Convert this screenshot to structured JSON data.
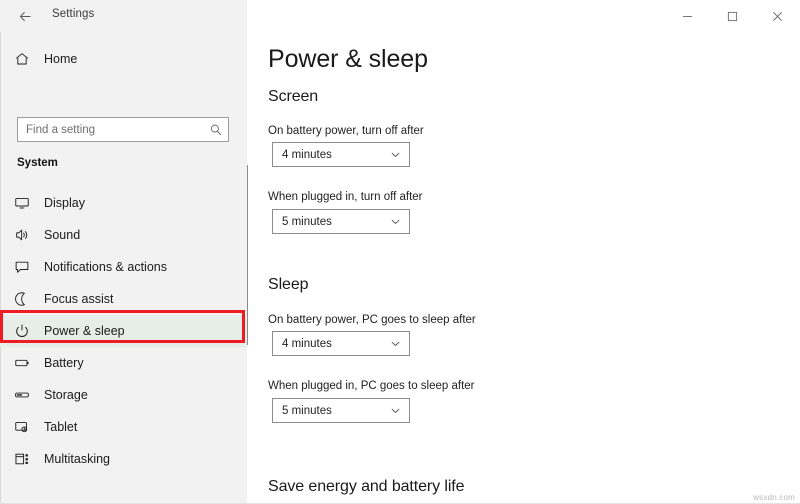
{
  "window": {
    "title": "Settings",
    "back_icon": "back-arrow-icon",
    "controls": [
      {
        "name": "minimize",
        "glyph": "─"
      },
      {
        "name": "maximize",
        "glyph": "□"
      },
      {
        "name": "close",
        "glyph": "✕"
      }
    ]
  },
  "sidebar": {
    "home": {
      "label": "Home",
      "icon": "home-icon"
    },
    "search": {
      "value": "",
      "placeholder": "Find a setting",
      "icon": "search-icon"
    },
    "group_label": "System",
    "items": [
      {
        "label": "Display",
        "icon": "monitor-icon",
        "selected": false
      },
      {
        "label": "Sound",
        "icon": "speaker-icon",
        "selected": false
      },
      {
        "label": "Notifications & actions",
        "icon": "notification-icon",
        "selected": false
      },
      {
        "label": "Focus assist",
        "icon": "moon-icon",
        "selected": false
      },
      {
        "label": "Power & sleep",
        "icon": "power-icon",
        "selected": true
      },
      {
        "label": "Battery",
        "icon": "battery-icon",
        "selected": false
      },
      {
        "label": "Storage",
        "icon": "storage-icon",
        "selected": false
      },
      {
        "label": "Tablet",
        "icon": "tablet-icon",
        "selected": false
      },
      {
        "label": "Multitasking",
        "icon": "multitasking-icon",
        "selected": false
      }
    ],
    "highlight_color": "#ee1d24",
    "selected_bg": "#e7eee9"
  },
  "main": {
    "page_title": "Power & sleep",
    "sections": [
      {
        "heading": "Screen",
        "fields": [
          {
            "label": "On battery power, turn off after",
            "value": "4 minutes"
          },
          {
            "label": "When plugged in, turn off after",
            "value": "5 minutes"
          }
        ]
      },
      {
        "heading": "Sleep",
        "fields": [
          {
            "label": "On battery power, PC goes to sleep after",
            "value": "4 minutes"
          },
          {
            "label": "When plugged in, PC goes to sleep after",
            "value": "5 minutes"
          }
        ]
      },
      {
        "heading": "Save energy and battery life",
        "fields": []
      }
    ]
  },
  "watermark": "wsxdn.com"
}
